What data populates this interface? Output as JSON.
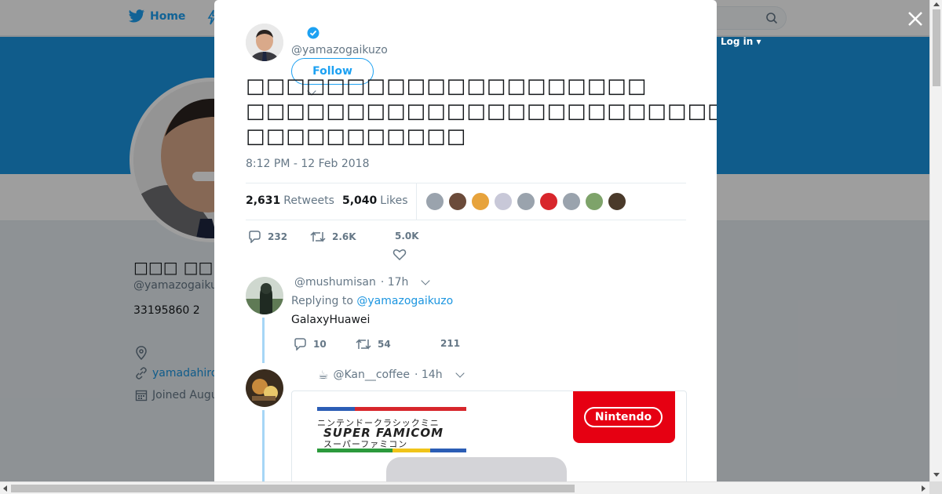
{
  "nav": {
    "home_label": "Home",
    "login_label": "Log in ▾"
  },
  "profile": {
    "display_name": "□□□ □□□□□□",
    "handle": "@yamazogaikuzo",
    "bio_stats": "33195860 2",
    "url": "yamadahiro",
    "joined": "Joined August"
  },
  "tweet": {
    "author_handle": "@yamazogaikuzo",
    "follow_label": "Follow",
    "text_lines": [
      "□□□□□□□□□□□□□□□□□□□□",
      "□□□□□□□□□□□□□□□□□□□□□□□□□□□□□□□□□□□□□□□□□□□□□□□□□□□□□□□□□□PR□□",
      "□□□□□□□□□□□"
    ],
    "timestamp": "8:12 PM - 12 Feb 2018",
    "retweets_count": "2,631",
    "retweets_label": "Retweets",
    "likes_count": "5,040",
    "likes_label": "Likes",
    "reply_count": "232",
    "retweet_count_short": "2.6K",
    "like_count_short": "5.0K"
  },
  "likers_colors": [
    "#9aa3ad",
    "#6b4b3a",
    "#e7a33c",
    "#c8c8d8",
    "#9aa3ad",
    "#d8262c",
    "#9aa3ad",
    "#7ea36a",
    "#4a3a2a"
  ],
  "replies": [
    {
      "handle": "@mushumisan",
      "time": "· 17h",
      "replying_prefix": "Replying to",
      "replying_to": "@yamazogaikuzo",
      "text": "GalaxyHuawei",
      "reply_count": "10",
      "retweet_count": "54",
      "like_count": "211"
    },
    {
      "handle_prefix": "☕",
      "handle": "@Kan__coffee",
      "time": "· 14h",
      "media": {
        "line1": "ニンテンドークラシックミニ",
        "line2": "SUPER FAMICOM",
        "line3": "スーパーファミコン",
        "brand": "Nintendo"
      }
    }
  ],
  "colors": {
    "accent": "#1da1f2",
    "banner": "#1b95e0",
    "thread_line": "#a6d6f6",
    "nintendo_red": "#e60012"
  }
}
